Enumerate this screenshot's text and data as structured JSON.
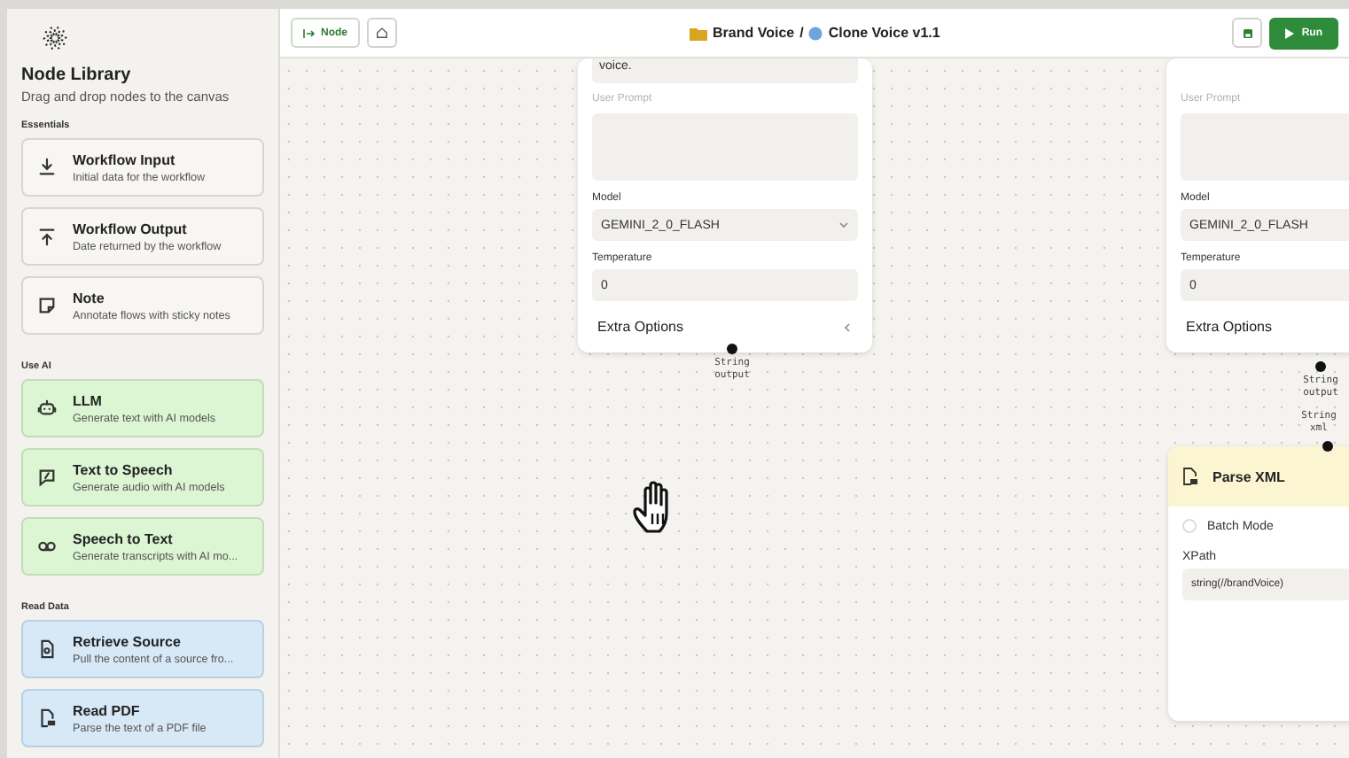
{
  "sidebar": {
    "title": "Node Library",
    "subtitle": "Drag and drop nodes to the canvas",
    "sections": [
      {
        "label": "Essentials",
        "kind": "essentials",
        "items": [
          {
            "kind": "input",
            "title": "Workflow Input",
            "description": "Initial data for the workflow"
          },
          {
            "kind": "output",
            "title": "Workflow Output",
            "description": "Date returned by the workflow"
          },
          {
            "kind": "note",
            "title": "Note",
            "description": "Annotate flows with sticky notes"
          }
        ]
      },
      {
        "label": "Use AI",
        "kind": "ai",
        "items": [
          {
            "kind": "robot",
            "title": "LLM",
            "description": "Generate text with AI models"
          },
          {
            "kind": "speech",
            "title": "Text to Speech",
            "description": "Generate audio with AI models"
          },
          {
            "kind": "voicemail",
            "title": "Speech to Text",
            "description": "Generate transcripts with AI mo..."
          }
        ]
      },
      {
        "label": "Read Data",
        "kind": "data",
        "items": [
          {
            "kind": "source",
            "title": "Retrieve Source",
            "description": "Pull the content of a source fro..."
          },
          {
            "kind": "pdf",
            "title": "Read PDF",
            "description": "Parse the text of a PDF file"
          }
        ]
      }
    ]
  },
  "header": {
    "add_node_button": "Node",
    "breadcrumb": {
      "folder": "Brand Voice",
      "separator": "/",
      "workflow": "Clone Voice v1.1"
    },
    "run_button": "Run"
  },
  "canvas": {
    "nodes": [
      {
        "kind": "llm",
        "system_prompt_value": "voice.",
        "user_prompt_placeholder": "User Prompt",
        "model_label": "Model",
        "model": "GEMINI_2_0_FLASH",
        "temperature_label": "Temperature",
        "temperature": "0",
        "extra_options": "Extra Options",
        "output_handle": "String output"
      },
      {
        "kind": "llm",
        "user_prompt_placeholder": "User Prompt",
        "model_label": "Model",
        "model": "GEMINI_2_0_FLASH",
        "temperature_label": "Temperature",
        "temperature": "0",
        "extra_options": "Extra Options",
        "output_handle": "String output"
      },
      {
        "kind": "parse_xml",
        "input_handle": "String xml",
        "title": "Parse XML",
        "batch_mode_label": "Batch Mode",
        "batch_mode": false,
        "xpath_label": "XPath",
        "xpath": "string(//brandVoice)"
      }
    ]
  }
}
